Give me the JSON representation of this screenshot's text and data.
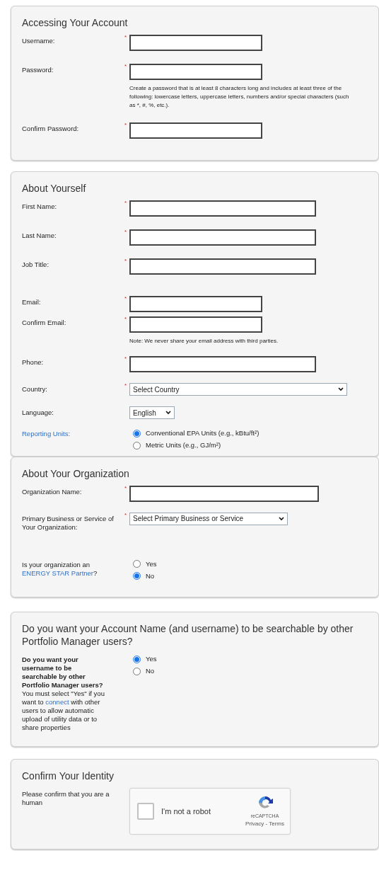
{
  "sections": [
    {
      "title": "Accessing Your Account",
      "fields": [
        {
          "kind": "text",
          "label": "Username:",
          "required_mark": "*"
        },
        {
          "kind": "text",
          "label": "Password:",
          "required_mark": "*",
          "hint": "Create a password that is at least 8 characters long and includes at least three of the following: lowercase letters, uppercase letters, numbers and/or special characters (such as *, #, %, etc.)."
        },
        {
          "kind": "text",
          "label": "Confirm Password:",
          "required_mark": "*"
        }
      ]
    },
    {
      "title": "About Yourself",
      "fields": [
        {
          "kind": "text",
          "label": "First Name:",
          "required_mark": "*"
        },
        {
          "kind": "text",
          "label": "Last Name:",
          "required_mark": "*"
        },
        {
          "kind": "text",
          "label": "Job Title:",
          "required_mark": "*"
        },
        {
          "kind": "text",
          "label": "Email:",
          "required_mark": "*"
        },
        {
          "kind": "text",
          "label": "Confirm Email:",
          "required_mark": "*",
          "hint": "Note: We never share your email address with third parties."
        },
        {
          "kind": "text",
          "label": "Phone:",
          "required_mark": "*"
        },
        {
          "kind": "select",
          "label": "Country:",
          "required_mark": "*",
          "value": "Select Country"
        },
        {
          "kind": "select",
          "label": "Language:",
          "value": "English"
        },
        {
          "kind": "radio",
          "label_parts": [
            {
              "kind": "link",
              "text": "Reporting Units:"
            }
          ],
          "options": [
            {
              "label": "Conventional EPA Units (e.g., kBtu/ft²)",
              "selected": true
            },
            {
              "label": "Metric Units (e.g., GJ/m²)",
              "selected": false
            }
          ]
        }
      ]
    },
    {
      "title": "About Your Organization",
      "fields": [
        {
          "kind": "text",
          "label": "Organization Name:",
          "required_mark": "*"
        },
        {
          "kind": "select",
          "label": "Primary Business or Service of Your Organization:",
          "required_mark": "*",
          "value": "Select Primary Business or Service"
        },
        {
          "kind": "radio",
          "label_parts": [
            {
              "kind": "plain",
              "text": "Is your organization an "
            },
            {
              "kind": "link",
              "text": "ENERGY STAR Partner"
            },
            {
              "kind": "plain",
              "text": "?"
            }
          ],
          "options": [
            {
              "label": "Yes",
              "selected": false
            },
            {
              "label": "No",
              "selected": true
            }
          ]
        }
      ]
    },
    {
      "title": "Do you want your Account Name (and username) to be searchable by other Portfolio Manager users?",
      "fields": [
        {
          "kind": "radio",
          "label_parts": [
            {
              "kind": "plain",
              "text": "**Do you want your username to be searchable by other Portfolio Manager users?** You must select \"Yes\" if you want to "
            },
            {
              "kind": "link",
              "text": "connect"
            },
            {
              "kind": "plain",
              "text": " with other users to allow automatic upload of utility data or to share properties"
            }
          ],
          "options": [
            {
              "label": "Yes",
              "selected": true
            },
            {
              "label": "No",
              "selected": false
            }
          ]
        }
      ]
    },
    {
      "title": "Confirm Your Identity",
      "fields": [
        {
          "kind": "captcha",
          "label": "Please confirm that you are a human",
          "checkbox_label": "I'm not a robot",
          "checked": false,
          "brand": "reCAPTCHA",
          "links": "Privacy - Terms"
        }
      ]
    }
  ]
}
